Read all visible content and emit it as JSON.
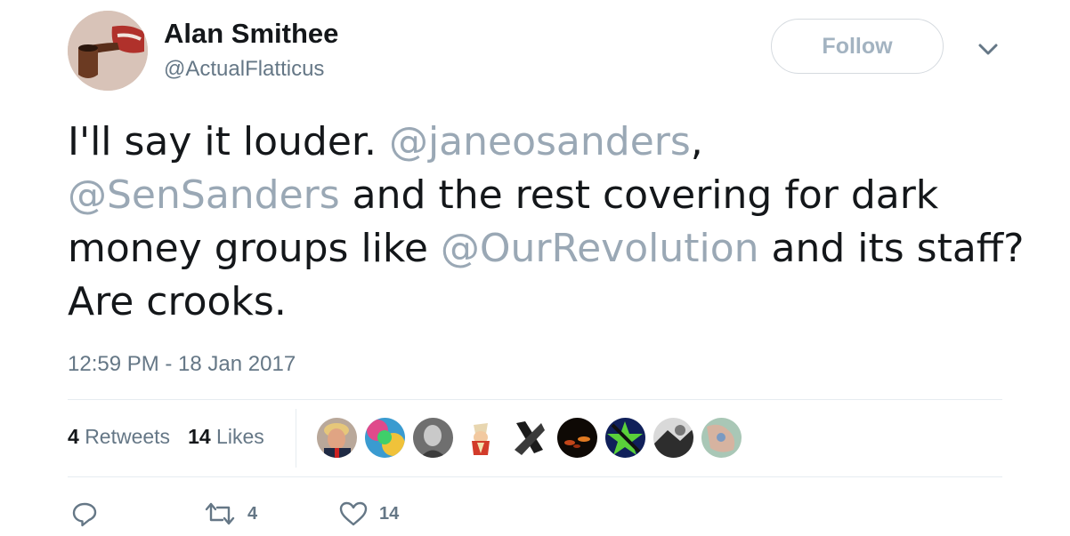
{
  "author": {
    "name": "Alan Smithee",
    "handle": "@ActualFlatticus",
    "avatar_icon": "pipe-lips-avatar"
  },
  "follow_label": "Follow",
  "menu_icon": "chevron-down-icon",
  "tweet": {
    "segments": [
      {
        "text": "I'll say it louder. ",
        "mention": false
      },
      {
        "text": "@janeosanders",
        "mention": true
      },
      {
        "text": ", ",
        "mention": false
      },
      {
        "text": "@SenSanders",
        "mention": true
      },
      {
        "text": " and the rest covering for dark money groups like ",
        "mention": false
      },
      {
        "text": "@OurRevolution",
        "mention": true
      },
      {
        "text": " and its staff?  Are crooks.",
        "mention": false
      }
    ]
  },
  "timestamp": "12:59 PM - 18 Jan 2017",
  "stats": {
    "retweets_count": "4",
    "retweets_label": "Retweets",
    "likes_count": "14",
    "likes_label": "Likes"
  },
  "likers": [
    {
      "icon": "avatar-trump",
      "color": "#c9a58a"
    },
    {
      "icon": "avatar-colorful",
      "color": "#d94c8a"
    },
    {
      "icon": "avatar-grayscale-woman",
      "color": "#8a8a8a"
    },
    {
      "icon": "avatar-cartoon",
      "color": "#e8d6b0"
    },
    {
      "icon": "avatar-black-x",
      "color": "#222222"
    },
    {
      "icon": "avatar-dark-fire",
      "color": "#1a0e08"
    },
    {
      "icon": "avatar-green-star",
      "color": "#2f8a3a"
    },
    {
      "icon": "avatar-bw-photo",
      "color": "#5a5a5a"
    },
    {
      "icon": "avatar-pastel-map",
      "color": "#9fbfae"
    }
  ],
  "actions": {
    "reply_icon": "reply-icon",
    "retweet_icon": "retweet-icon",
    "retweet_count": "4",
    "like_icon": "heart-icon",
    "like_count": "14"
  },
  "colors": {
    "mention": "#9aa8b5",
    "secondary_text": "#657786",
    "divider": "#e6ecf0"
  }
}
